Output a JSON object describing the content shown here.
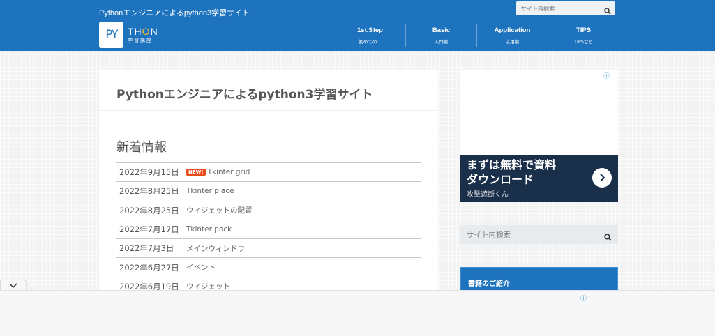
{
  "header": {
    "site_description": "Pythonエンジニアによるpython3学習サイト",
    "logo": {
      "letters": "PY",
      "wordmark_prefix": "TH",
      "wordmark_o": "O",
      "wordmark_suffix": "N",
      "subtitle": "学習講座"
    },
    "search": {
      "placeholder": "サイト内検索"
    },
    "nav": [
      {
        "label": "1st.Step",
        "sub": "初めての..."
      },
      {
        "label": "Basic",
        "sub": "入門編"
      },
      {
        "label": "Application",
        "sub": "応用編"
      },
      {
        "label": "TIPS",
        "sub": "TIPSなど"
      }
    ]
  },
  "main": {
    "title": "Pythonエンジニアによるpython3学習サイト",
    "news_heading": "新着情報",
    "news": [
      {
        "date": "2022年9月15日",
        "badge": "NEW!",
        "title": "Tkinter grid"
      },
      {
        "date": "2022年8月25日",
        "badge": "",
        "title": "Tkinter place"
      },
      {
        "date": "2022年8月25日",
        "badge": "",
        "title": "ウィジェットの配置"
      },
      {
        "date": "2022年7月17日",
        "badge": "",
        "title": "Tkinter pack"
      },
      {
        "date": "2022年7月3日",
        "badge": "",
        "title": "メインウィンドウ"
      },
      {
        "date": "2022年6月27日",
        "badge": "",
        "title": "イベント"
      },
      {
        "date": "2022年6月19日",
        "badge": "",
        "title": "ウィジェット"
      }
    ]
  },
  "sidebar": {
    "ad": {
      "info_icon": "ⓘ",
      "line1": "まずは無料で資料",
      "line2": "ダウンロード",
      "company": "攻撃遮断くん"
    },
    "search": {
      "placeholder": "サイト内検索"
    },
    "book_box": {
      "title": "書籍のご紹介"
    }
  },
  "bottom_ad": {
    "info_icon": "ⓘ"
  },
  "colors": {
    "header_bg": "#1e73be",
    "badge_bg": "#e84c1c",
    "ad_banner_bg": "#1a2f4a",
    "logo_accent": "#f5c12e"
  }
}
